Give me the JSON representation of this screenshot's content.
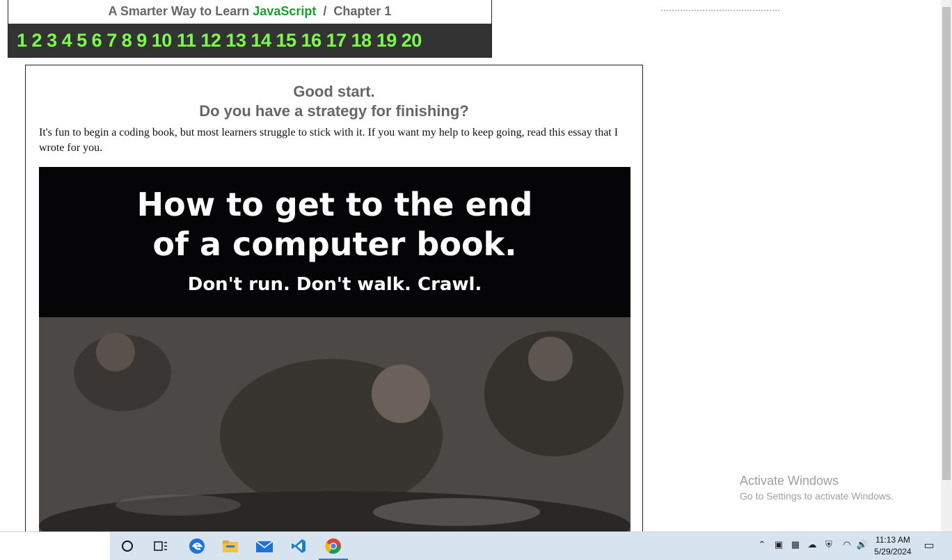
{
  "header": {
    "title_prefix": "A Smarter Way to Learn",
    "title_highlight": "JavaScript",
    "title_separator": "/",
    "title_chapter": "Chapter 1",
    "chapters": [
      "1",
      "2",
      "3",
      "4",
      "5",
      "6",
      "7",
      "8",
      "9",
      "10",
      "11",
      "12",
      "13",
      "14",
      "15",
      "16",
      "17",
      "18",
      "19",
      "20"
    ]
  },
  "card": {
    "heading_line1": "Good start.",
    "heading_line2": "Do you have a strategy for finishing?",
    "intro": "It's fun to begin a coding book, but most learners struggle to stick with it. If you want my help to keep going, read this essay that I wrote for you.",
    "banner_title_line1": "How to get to the end",
    "banner_title_line2": "of a computer book.",
    "banner_subtitle": "Don't run. Don't walk. Crawl."
  },
  "watermark": {
    "line1": "Activate Windows",
    "line2": "Go to Settings to activate Windows."
  },
  "taskbar": {
    "time": "11:13 AM",
    "date": "5/29/2024",
    "apps": [
      "search-icon",
      "task-view-icon",
      "edge-icon",
      "file-explorer-icon",
      "mail-icon",
      "vscode-icon",
      "chrome-icon"
    ]
  },
  "colors": {
    "chapter_link": "#7cff4c",
    "chapter_bar": "#333333",
    "js_highlight": "#1a9e2c"
  }
}
